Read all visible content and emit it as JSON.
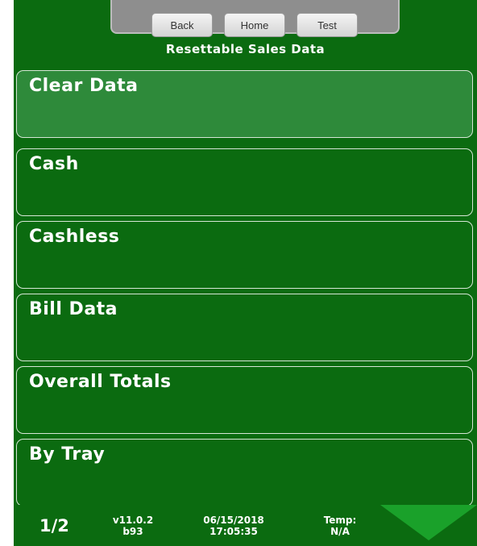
{
  "nav": {
    "back_label": "Back",
    "home_label": "Home",
    "test_label": "Test"
  },
  "page_title": "Resettable Sales Data",
  "menu": {
    "items": [
      {
        "label": "Clear Data",
        "active": true
      },
      {
        "label": "Cash"
      },
      {
        "label": "Cashless"
      },
      {
        "label": "Bill Data"
      },
      {
        "label": "Overall Totals"
      },
      {
        "label": "By Tray"
      }
    ]
  },
  "status": {
    "page": "1/2",
    "version": "v11.0.2",
    "build": "b93",
    "date": "06/15/2018",
    "time": "17:05:35",
    "temp_label": "Temp:",
    "temp_value": "N/A"
  },
  "colors": {
    "background": "#0b6b10",
    "active_item": "#2e8a3a",
    "nav_tray": "#8e8e8e",
    "next_arrow": "#1aa12a"
  },
  "icons": {
    "next_page": "down-triangle-icon"
  }
}
